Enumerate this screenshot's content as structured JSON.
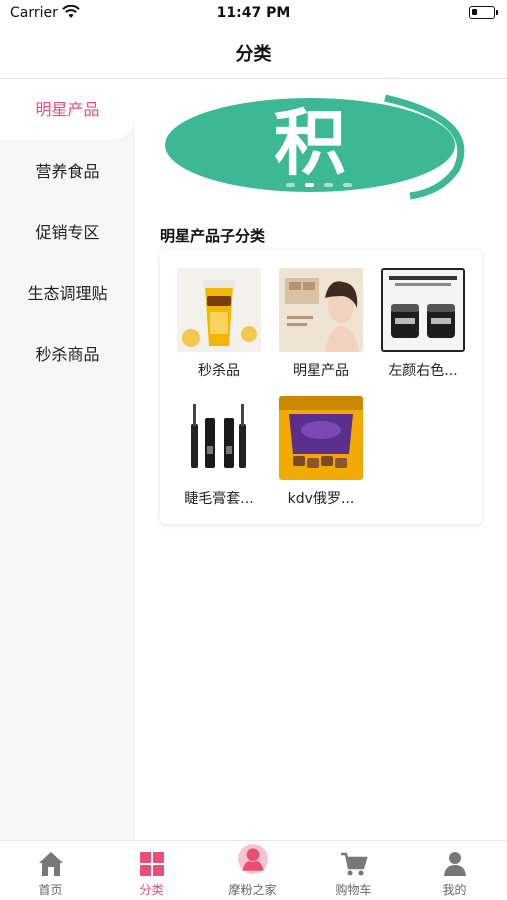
{
  "status_bar": {
    "carrier": "Carrier",
    "time": "11:47 PM"
  },
  "nav": {
    "title": "分类"
  },
  "sidebar": {
    "items": [
      {
        "label": "明星产品",
        "active": true
      },
      {
        "label": "营养食品",
        "active": false
      },
      {
        "label": "促销专区",
        "active": false
      },
      {
        "label": "生态调理贴",
        "active": false
      },
      {
        "label": "秒杀商品",
        "active": false
      }
    ]
  },
  "banner": {
    "text": "积",
    "icon": "ji-logo-banner"
  },
  "section": {
    "title": "明星产品子分类"
  },
  "products": [
    {
      "label": "秒杀品",
      "icon": "meco-drink-image"
    },
    {
      "label": "明星产品",
      "icon": "model-portrait-image"
    },
    {
      "label": "左颜右色...",
      "icon": "cosmetics-jars-image"
    },
    {
      "label": "睫毛膏套...",
      "icon": "mascara-image"
    },
    {
      "label": "kdv俄罗...",
      "icon": "kdv-candy-image"
    }
  ],
  "tabbar": {
    "items": [
      {
        "label": "首页",
        "icon": "home-icon",
        "active": false
      },
      {
        "label": "分类",
        "icon": "category-icon",
        "active": true
      },
      {
        "label": "摩粉之家",
        "icon": "mofen-home-icon",
        "active": false
      },
      {
        "label": "购物车",
        "icon": "cart-icon",
        "active": false
      },
      {
        "label": "我的",
        "icon": "user-icon",
        "active": false
      }
    ]
  },
  "colors": {
    "accent": "#e94e74",
    "brand_green": "#3db896",
    "sidebar_bg": "#f6f6f6"
  }
}
